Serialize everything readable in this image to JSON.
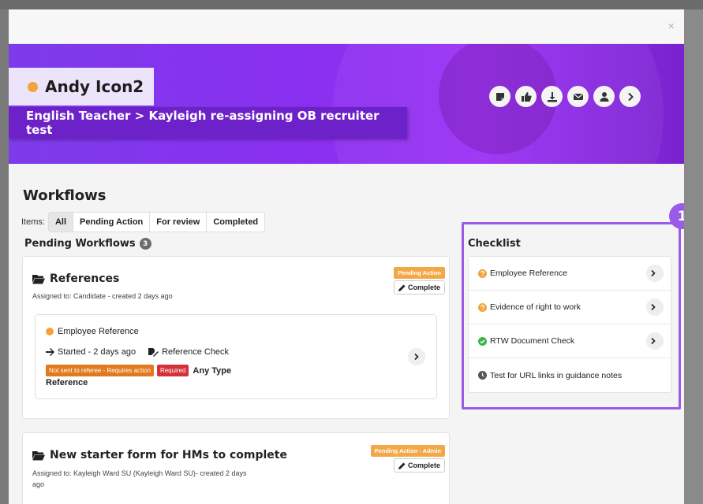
{
  "modal": {
    "close_label": "×"
  },
  "candidate": {
    "name": "Andy Icon2",
    "job_line": "English Teacher > Kayleigh re-assigning OB recruiter test"
  },
  "header_actions": [
    {
      "icon": "note-icon"
    },
    {
      "icon": "thumbs-up-icon"
    },
    {
      "icon": "download-icon"
    },
    {
      "icon": "email-icon"
    },
    {
      "icon": "user-icon"
    },
    {
      "icon": "chevron-right-icon"
    }
  ],
  "workflows": {
    "title": "Workflows",
    "items_label": "Items:",
    "tabs": [
      {
        "label": "All",
        "active": true
      },
      {
        "label": "Pending Action",
        "active": false
      },
      {
        "label": "For review",
        "active": false
      },
      {
        "label": "Completed",
        "active": false
      }
    ],
    "pending_title": "Pending Workflows",
    "pending_count": "3"
  },
  "cards": [
    {
      "title": "References",
      "assigned": "Assigned to: Candidate - created 2 days ago",
      "badge": "Pending Action",
      "complete_label": "Complete",
      "item": {
        "name": "Employee Reference",
        "started": "Started - 2 days ago",
        "check": "Reference Check",
        "badge_status": "Not sent to referee - Requires action",
        "badge_required": "Required",
        "type_text": "Any Type",
        "type_text2": "Reference"
      }
    },
    {
      "title": "New starter form for HMs to complete",
      "assigned_line1": "Assigned to: Kayleigh Ward SU (Kayleigh Ward SU)- created 2 days",
      "assigned_line2": "ago",
      "badge": "Pending Action - Admin",
      "complete_label": "Complete"
    }
  ],
  "checklist": {
    "title": "Checklist",
    "marker": "1",
    "items": [
      {
        "label": "Employee Reference",
        "status": "question",
        "color": "#f2a33a"
      },
      {
        "label": "Evidence of right to work",
        "status": "question",
        "color": "#f2a33a"
      },
      {
        "label": "RTW Document Check",
        "status": "done",
        "color": "#3ab54a"
      },
      {
        "label": "Test for URL links in guidance notes",
        "status": "clock",
        "color": "#555555"
      }
    ]
  },
  "colors": {
    "hero": "#8a2ff0",
    "job_bar": "#6d22c9",
    "highlight": "#9a5be6",
    "pending_badge": "#f2a849",
    "required": "#d6303a"
  }
}
